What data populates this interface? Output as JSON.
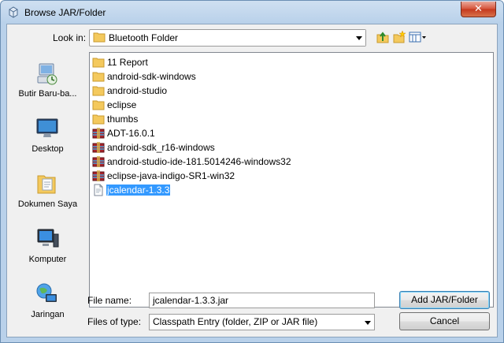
{
  "window": {
    "title": "Browse JAR/Folder",
    "close_glyph": "✕"
  },
  "toolbar": {
    "lookin_label": "Look in:",
    "lookin_value": "Bluetooth Folder",
    "icons": [
      "up-folder-icon",
      "new-folder-icon",
      "view-menu-icon"
    ]
  },
  "places": [
    {
      "label": "Butir Baru-ba...",
      "icon": "recent-items-icon"
    },
    {
      "label": "Desktop",
      "icon": "desktop-icon"
    },
    {
      "label": "Dokumen Saya",
      "icon": "documents-icon"
    },
    {
      "label": "Komputer",
      "icon": "computer-icon"
    },
    {
      "label": "Jaringan",
      "icon": "network-icon"
    }
  ],
  "files": [
    {
      "name": "11 Report",
      "type": "folder"
    },
    {
      "name": "android-sdk-windows",
      "type": "folder"
    },
    {
      "name": "android-studio",
      "type": "folder"
    },
    {
      "name": "eclipse",
      "type": "folder"
    },
    {
      "name": "thumbs",
      "type": "folder"
    },
    {
      "name": "ADT-16.0.1",
      "type": "archive"
    },
    {
      "name": "android-sdk_r16-windows",
      "type": "archive"
    },
    {
      "name": "android-studio-ide-181.5014246-windows32",
      "type": "archive"
    },
    {
      "name": "eclipse-java-indigo-SR1-win32",
      "type": "archive"
    },
    {
      "name": "jcalendar-1.3.3",
      "type": "jar",
      "selected": true
    }
  ],
  "form": {
    "filename_label": "File name:",
    "filename_value": "jcalendar-1.3.3.jar",
    "filetype_label": "Files of type:",
    "filetype_value": "Classpath Entry (folder, ZIP or JAR file)"
  },
  "buttons": {
    "add": "Add JAR/Folder",
    "cancel": "Cancel"
  },
  "colors": {
    "selection": "#3399ff",
    "frame": "#b9d1ea",
    "close": "#c4381d"
  }
}
